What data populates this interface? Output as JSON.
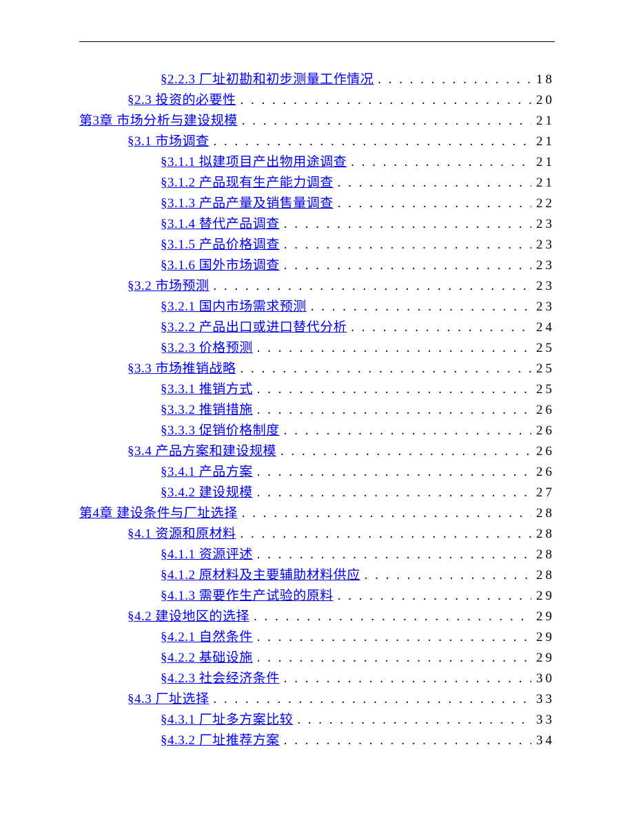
{
  "toc": [
    {
      "level": 2,
      "label": "§2.2.3 厂址初勘和初步测量工作情况",
      "page": "18"
    },
    {
      "level": 1,
      "label": "§2.3 投资的必要性",
      "page": "20"
    },
    {
      "level": 0,
      "label": "第3章 市场分析与建设规模",
      "page": "21"
    },
    {
      "level": 1,
      "label": "§3.1 市场调查",
      "page": "21"
    },
    {
      "level": 2,
      "label": "§3.1.1 拟建项目产出物用途调查",
      "page": "21"
    },
    {
      "level": 2,
      "label": "§3.1.2 产品现有生产能力调查",
      "page": "21"
    },
    {
      "level": 2,
      "label": "§3.1.3 产品产量及销售量调查",
      "page": "22"
    },
    {
      "level": 2,
      "label": "§3.1.4 替代产品调查",
      "page": "23"
    },
    {
      "level": 2,
      "label": "§3.1.5 产品价格调查",
      "page": "23"
    },
    {
      "level": 2,
      "label": "§3.1.6 国外市场调查",
      "page": "23"
    },
    {
      "level": 1,
      "label": "§3.2 市场预测",
      "page": "23"
    },
    {
      "level": 2,
      "label": "§3.2.1 国内市场需求预测",
      "page": "23"
    },
    {
      "level": 2,
      "label": "§3.2.2 产品出口或进口替代分析",
      "page": "24"
    },
    {
      "level": 2,
      "label": "§3.2.3 价格预测",
      "page": "25"
    },
    {
      "level": 1,
      "label": "§3.3 市场推销战略",
      "page": "25"
    },
    {
      "level": 2,
      "label": "§3.3.1 推销方式",
      "page": "25"
    },
    {
      "level": 2,
      "label": "§3.3.2 推销措施",
      "page": "26"
    },
    {
      "level": 2,
      "label": "§3.3.3 促销价格制度",
      "page": "26"
    },
    {
      "level": 1,
      "label": "§3.4 产品方案和建设规模",
      "page": "26"
    },
    {
      "level": 2,
      "label": "§3.4.1 产品方案",
      "page": "26"
    },
    {
      "level": 2,
      "label": "§3.4.2 建设规模",
      "page": "27"
    },
    {
      "level": 0,
      "label": "第4章 建设条件与厂址选择",
      "page": "28"
    },
    {
      "level": 1,
      "label": "§4.1 资源和原材料",
      "page": "28"
    },
    {
      "level": 2,
      "label": "§4.1.1 资源评述",
      "page": "28"
    },
    {
      "level": 2,
      "label": "§4.1.2 原材料及主要辅助材料供应",
      "page": "28"
    },
    {
      "level": 2,
      "label": "§4.1.3 需要作生产试验的原料",
      "page": "29"
    },
    {
      "level": 1,
      "label": "§4.2 建设地区的选择",
      "page": "29"
    },
    {
      "level": 2,
      "label": "§4.2.1 自然条件",
      "page": "29"
    },
    {
      "level": 2,
      "label": "§4.2.2 基础设施",
      "page": "29"
    },
    {
      "level": 2,
      "label": "§4.2.3 社会经济条件",
      "page": "30"
    },
    {
      "level": 1,
      "label": "§4.3 厂址选择",
      "page": "33"
    },
    {
      "level": 2,
      "label": "§4.3.1 厂址多方案比较",
      "page": "33"
    },
    {
      "level": 2,
      "label": "§4.3.2 厂址推荐方案",
      "page": "34"
    }
  ]
}
